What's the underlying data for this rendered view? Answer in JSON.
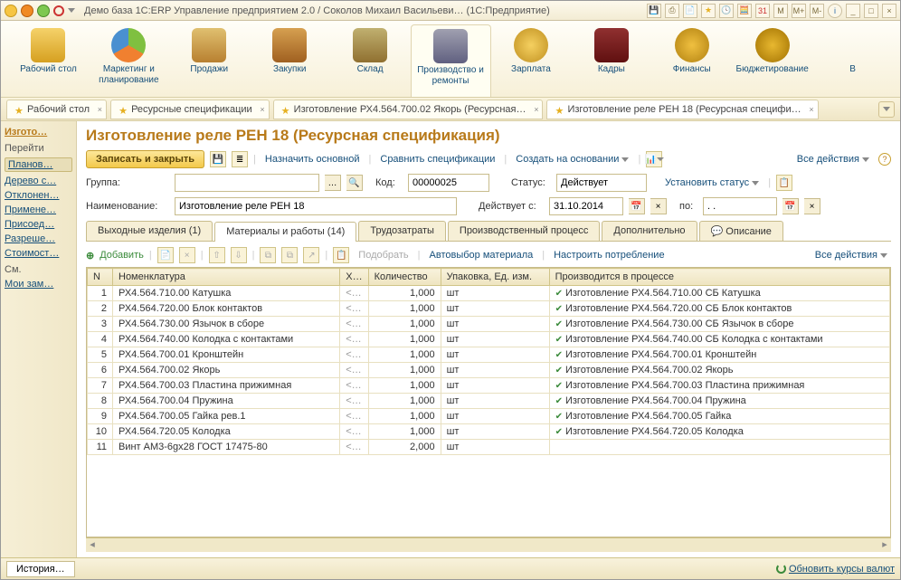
{
  "app_title": "Демо база 1С:ERP Управление предприятием 2.0 / Соколов Михаил Васильеви… (1С:Предприятие)",
  "title_right": {
    "m": "M",
    "mplus": "M+",
    "mminus": "M-"
  },
  "main_toolbar": [
    {
      "label": "Рабочий стол",
      "icon": "ic-desk"
    },
    {
      "label": "Маркетинг и планирование",
      "icon": "ic-pie"
    },
    {
      "label": "Продажи",
      "icon": "ic-truck"
    },
    {
      "label": "Закупки",
      "icon": "ic-boxes"
    },
    {
      "label": "Склад",
      "icon": "ic-racks"
    },
    {
      "label": "Производство и ремонты",
      "icon": "ic-factory",
      "active": true
    },
    {
      "label": "Зарплата",
      "icon": "ic-coins"
    },
    {
      "label": "Кадры",
      "icon": "ic-book"
    },
    {
      "label": "Финансы",
      "icon": "ic-fin"
    },
    {
      "label": "Бюджетирование",
      "icon": "ic-budget"
    },
    {
      "label": "В",
      "icon": ""
    }
  ],
  "window_tabs": [
    {
      "label": "Рабочий стол"
    },
    {
      "label": "Ресурсные спецификации"
    },
    {
      "label": "Изготовление РХ4.564.700.02 Якорь (Ресурсная…"
    },
    {
      "label": "Изготовление реле РЕН 18 (Ресурсная специфи…",
      "active": true
    }
  ],
  "sidebar": {
    "top": "Изгото…",
    "group1": "Перейти",
    "link_planov": "Планов…",
    "links": [
      "Дерево с…",
      "Отклонен…",
      "Примене…",
      "Присоед…",
      "Разреше…",
      "Стоимост…"
    ],
    "group2": "См.",
    "links2": [
      "Мои зам…"
    ]
  },
  "page_title": "Изготовление реле РЕН 18 (Ресурсная спецификация)",
  "actions": {
    "save_close": "Записать и закрыть",
    "assign_main": "Назначить основной",
    "compare": "Сравнить спецификации",
    "create_based": "Создать на основании",
    "all_actions": "Все действия"
  },
  "form": {
    "group_label": "Группа:",
    "group_value": "",
    "code_label": "Код:",
    "code_value": "00000025",
    "status_label": "Статус:",
    "status_value": "Действует",
    "set_status": "Установить статус",
    "name_label": "Наименование:",
    "name_value": "Изготовление реле РЕН 18",
    "valid_from_label": "Действует с:",
    "valid_from_value": "31.10.2014",
    "to_label": "по:",
    "to_value": ". .   "
  },
  "inner_tabs": [
    "Выходные изделия (1)",
    "Материалы и работы (14)",
    "Трудозатраты",
    "Производственный процесс",
    "Дополнительно",
    "Описание"
  ],
  "tbl_actions": {
    "add": "Добавить",
    "pick": "Подобрать",
    "auto": "Автовыбор материала",
    "configure": "Настроить потребление",
    "all": "Все действия"
  },
  "columns": [
    "N",
    "Номенклатура",
    "Х…",
    "Количество",
    "Упаковка, Ед. изм.",
    "Производится в процессе"
  ],
  "rows": [
    {
      "n": 1,
      "nom": "РХ4.564.710.00 Катушка",
      "x": "<…",
      "qty": "1,000",
      "unit": "шт",
      "proc": "Изготовление РХ4.564.710.00 СБ Катушка"
    },
    {
      "n": 2,
      "nom": "РХ4.564.720.00 Блок контактов",
      "x": "<…",
      "qty": "1,000",
      "unit": "шт",
      "proc": "Изготовление РХ4.564.720.00 СБ Блок контактов"
    },
    {
      "n": 3,
      "nom": "РХ4.564.730.00 Язычок в сборе",
      "x": "<…",
      "qty": "1,000",
      "unit": "шт",
      "proc": "Изготовление РХ4.564.730.00 СБ Язычок в сборе"
    },
    {
      "n": 4,
      "nom": "РХ4.564.740.00 Колодка с контактами",
      "x": "<…",
      "qty": "1,000",
      "unit": "шт",
      "proc": "Изготовление РХ4.564.740.00 СБ Колодка с контактами"
    },
    {
      "n": 5,
      "nom": "РХ4.564.700.01 Кронштейн",
      "x": "<…",
      "qty": "1,000",
      "unit": "шт",
      "proc": "Изготовление РХ4.564.700.01 Кронштейн"
    },
    {
      "n": 6,
      "nom": "РХ4.564.700.02 Якорь",
      "x": "<…",
      "qty": "1,000",
      "unit": "шт",
      "proc": "Изготовление РХ4.564.700.02 Якорь"
    },
    {
      "n": 7,
      "nom": "РХ4.564.700.03 Пластина прижимная",
      "x": "<…",
      "qty": "1,000",
      "unit": "шт",
      "proc": "Изготовление РХ4.564.700.03 Пластина прижимная"
    },
    {
      "n": 8,
      "nom": "РХ4.564.700.04 Пружина",
      "x": "<…",
      "qty": "1,000",
      "unit": "шт",
      "proc": "Изготовление РХ4.564.700.04 Пружина"
    },
    {
      "n": 9,
      "nom": "РХ4.564.700.05 Гайка рев.1",
      "x": "<…",
      "qty": "1,000",
      "unit": "шт",
      "proc": "Изготовление РХ4.564.700.05 Гайка"
    },
    {
      "n": 10,
      "nom": "РХ4.564.720.05 Колодка",
      "x": "<…",
      "qty": "1,000",
      "unit": "шт",
      "proc": "Изготовление РХ4.564.720.05 Колодка"
    },
    {
      "n": 11,
      "nom": "Винт АМ3-6gx28 ГОСТ 17475-80",
      "x": "<…",
      "qty": "2,000",
      "unit": "шт",
      "proc": ""
    }
  ],
  "status": {
    "history": "История…",
    "refresh": "Обновить курсы валют"
  }
}
